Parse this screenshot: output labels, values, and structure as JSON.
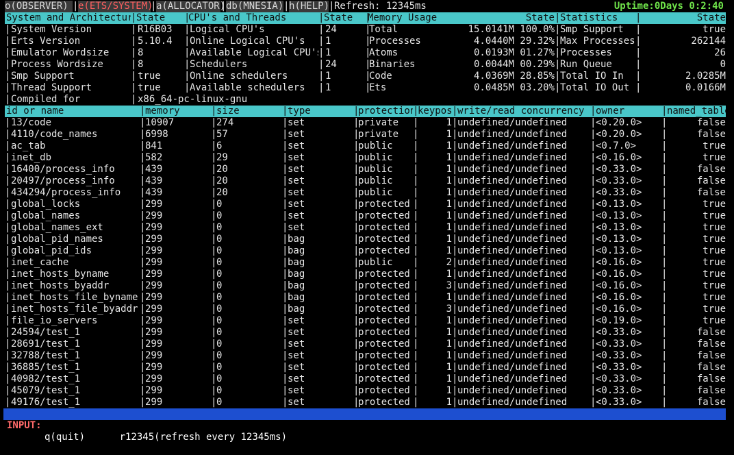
{
  "tabs": [
    {
      "label": "o(OBSERVER)",
      "active": false
    },
    {
      "label": "e(ETS/SYSTEM)",
      "active": true
    },
    {
      "label": "a(ALLOCATOR)",
      "active": false
    },
    {
      "label": "db(MNESIA)",
      "active": false
    },
    {
      "label": "h(HELP)",
      "active": false
    }
  ],
  "refresh_text": "Refresh: 12345ms",
  "uptime": "Uptime:0Days 0:2:40",
  "system_headers": [
    "System and Architecture",
    "State",
    "CPU's and Threads",
    "State",
    "Memory Usage",
    "State",
    "Statistics",
    "State"
  ],
  "system_rows": [
    [
      "System Version",
      "R16B03",
      "Logical CPU's",
      "24",
      "Total",
      "15.0141M 100.0%",
      "Smp Support",
      "true"
    ],
    [
      "Erts Version",
      "5.10.4",
      "Online Logical CPU's",
      "1",
      "Processes",
      "4.0440M 29.32%",
      "Max Processes",
      "262144"
    ],
    [
      "Emulator Wordsize",
      "8",
      "Available Logical CPU's",
      "1",
      "Atoms",
      "0.0193M 01.27%",
      "Processes",
      "26"
    ],
    [
      "Process Wordsize",
      "8",
      "Schedulers",
      "24",
      "Binaries",
      "0.0044M 00.29%",
      "Run Queue",
      "0"
    ],
    [
      "Smp Support",
      "true",
      "Online schedulers",
      "1",
      "Code",
      "4.0369M 28.85%",
      "Total IO In",
      "2.0285M"
    ],
    [
      "Thread Support",
      "true",
      "Available schedulers",
      "1",
      "Ets",
      "0.0485M 03.20%",
      "Total IO Out",
      "0.0166M"
    ]
  ],
  "compiled_for": {
    "label": "Compiled for",
    "value": "x86_64-pc-linux-gnu"
  },
  "ets_headers": [
    "id or name",
    "memory",
    "size",
    "type",
    "protection",
    "keypos",
    "write/read concurrency",
    "owner",
    "named_table"
  ],
  "ets_rows": [
    [
      "13/code",
      "10907",
      "274",
      "set",
      "private",
      "1",
      "undefined/undefined",
      "<0.20.0>",
      "false"
    ],
    [
      "4110/code_names",
      "6998",
      "57",
      "set",
      "private",
      "1",
      "undefined/undefined",
      "<0.20.0>",
      "false"
    ],
    [
      "ac_tab",
      "841",
      "6",
      "set",
      "public",
      "1",
      "undefined/undefined",
      "<0.7.0>",
      "true"
    ],
    [
      "inet_db",
      "582",
      "29",
      "set",
      "public",
      "1",
      "undefined/undefined",
      "<0.16.0>",
      "true"
    ],
    [
      "16400/process_info",
      "439",
      "20",
      "set",
      "public",
      "1",
      "undefined/undefined",
      "<0.33.0>",
      "false"
    ],
    [
      "20497/process_info",
      "439",
      "20",
      "set",
      "public",
      "1",
      "undefined/undefined",
      "<0.33.0>",
      "false"
    ],
    [
      "434294/process_info",
      "439",
      "20",
      "set",
      "public",
      "1",
      "undefined/undefined",
      "<0.33.0>",
      "false"
    ],
    [
      "global_locks",
      "299",
      "0",
      "set",
      "protected",
      "1",
      "undefined/undefined",
      "<0.13.0>",
      "true"
    ],
    [
      "global_names",
      "299",
      "0",
      "set",
      "protected",
      "1",
      "undefined/undefined",
      "<0.13.0>",
      "true"
    ],
    [
      "global_names_ext",
      "299",
      "0",
      "set",
      "protected",
      "1",
      "undefined/undefined",
      "<0.13.0>",
      "true"
    ],
    [
      "global_pid_names",
      "299",
      "0",
      "bag",
      "protected",
      "1",
      "undefined/undefined",
      "<0.13.0>",
      "true"
    ],
    [
      "global_pid_ids",
      "299",
      "0",
      "bag",
      "protected",
      "1",
      "undefined/undefined",
      "<0.13.0>",
      "true"
    ],
    [
      "inet_cache",
      "299",
      "0",
      "bag",
      "public",
      "2",
      "undefined/undefined",
      "<0.16.0>",
      "true"
    ],
    [
      "inet_hosts_byname",
      "299",
      "0",
      "bag",
      "protected",
      "1",
      "undefined/undefined",
      "<0.16.0>",
      "true"
    ],
    [
      "inet_hosts_byaddr",
      "299",
      "0",
      "bag",
      "protected",
      "3",
      "undefined/undefined",
      "<0.16.0>",
      "true"
    ],
    [
      "inet_hosts_file_byname",
      "299",
      "0",
      "bag",
      "protected",
      "1",
      "undefined/undefined",
      "<0.16.0>",
      "true"
    ],
    [
      "inet_hosts_file_byaddr",
      "299",
      "0",
      "bag",
      "protected",
      "3",
      "undefined/undefined",
      "<0.16.0>",
      "true"
    ],
    [
      "file_io_servers",
      "299",
      "0",
      "set",
      "protected",
      "1",
      "undefined/undefined",
      "<0.19.0>",
      "true"
    ],
    [
      "24594/test_1",
      "299",
      "0",
      "set",
      "protected",
      "1",
      "undefined/undefined",
      "<0.33.0>",
      "false"
    ],
    [
      "28691/test_1",
      "299",
      "0",
      "set",
      "protected",
      "1",
      "undefined/undefined",
      "<0.33.0>",
      "false"
    ],
    [
      "32788/test_1",
      "299",
      "0",
      "set",
      "protected",
      "1",
      "undefined/undefined",
      "<0.33.0>",
      "false"
    ],
    [
      "36885/test_1",
      "299",
      "0",
      "set",
      "protected",
      "1",
      "undefined/undefined",
      "<0.33.0>",
      "false"
    ],
    [
      "40982/test_1",
      "299",
      "0",
      "set",
      "protected",
      "1",
      "undefined/undefined",
      "<0.33.0>",
      "false"
    ],
    [
      "45079/test_1",
      "299",
      "0",
      "set",
      "protected",
      "1",
      "undefined/undefined",
      "<0.33.0>",
      "false"
    ],
    [
      "49176/test_1",
      "299",
      "0",
      "set",
      "protected",
      "1",
      "undefined/undefined",
      "<0.33.0>",
      "false"
    ]
  ],
  "input_bar": {
    "label": "INPUT:",
    "commands": "q(quit)      r12345(refresh every 12345ms)"
  },
  "colors": {
    "header_bg": "#49c7c9",
    "active_tab": "#ff5f5f",
    "uptime": "#6fe34a",
    "input_bg": "#1d4fd0"
  }
}
